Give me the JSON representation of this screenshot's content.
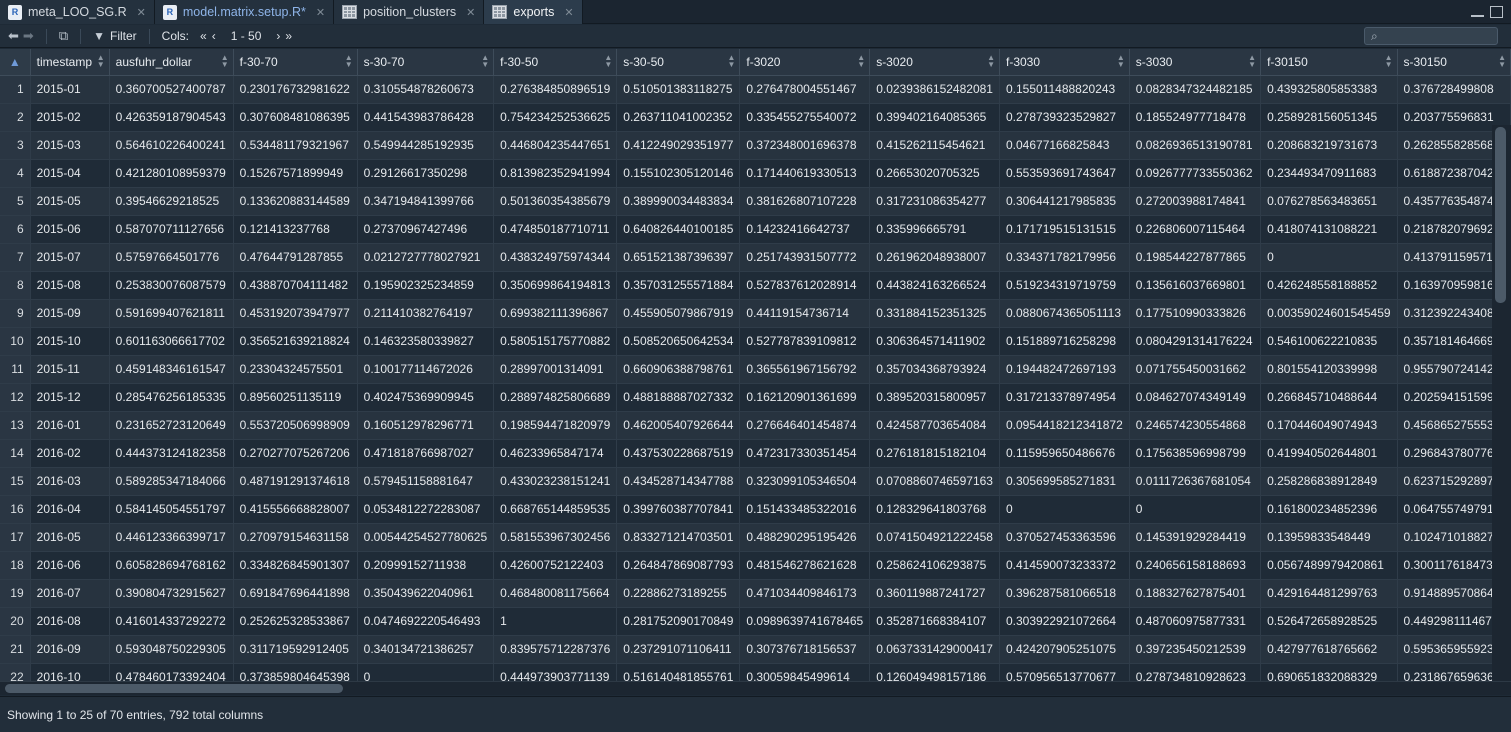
{
  "tabs": [
    {
      "label": "meta_LOO_SG.R",
      "type": "r-file",
      "modified": false,
      "active": false
    },
    {
      "label": "model.matrix.setup.R*",
      "type": "r-file",
      "modified": true,
      "active": false
    },
    {
      "label": "position_clusters",
      "type": "data",
      "modified": false,
      "active": false
    },
    {
      "label": "exports",
      "type": "data",
      "modified": false,
      "active": true
    }
  ],
  "toolbar": {
    "filter_label": "Filter",
    "cols_label": "Cols:",
    "col_range": "1 - 50"
  },
  "columns": [
    "timestamp",
    "ausfuhr_dollar",
    "f-30-70",
    "s-30-70",
    "f-30-50",
    "s-30-50",
    "f-3020",
    "s-3020",
    "f-3030",
    "s-3030",
    "f-30150",
    "s-30150"
  ],
  "rows": [
    [
      "1",
      "2015-01",
      "0.360700527400787",
      "0.230176732981622",
      "0.310554878260673",
      "0.276384850896519",
      "0.510501383118275",
      "0.276478004551467",
      "0.0239386152482081",
      "0.155011488820243",
      "0.0828347324482185",
      "0.439325805853383",
      "0.376728499808"
    ],
    [
      "2",
      "2015-02",
      "0.426359187904543",
      "0.307608481086395",
      "0.441543983786428",
      "0.754234252536625",
      "0.263711041002352",
      "0.335455275540072",
      "0.399402164085365",
      "0.278739323529827",
      "0.185524977718478",
      "0.258928156051345",
      "0.203775596831"
    ],
    [
      "3",
      "2015-03",
      "0.564610226400241",
      "0.534481179321967",
      "0.549944285192935",
      "0.446804235447651",
      "0.412249029351977",
      "0.372348001696378",
      "0.415262115454621",
      "0.04677166825843",
      "0.0826936513190781",
      "0.208683219731673",
      "0.262855828568"
    ],
    [
      "4",
      "2015-04",
      "0.421280108959379",
      "0.15267571899949",
      "0.29126617350298",
      "0.813982352941994",
      "0.155102305120146",
      "0.171440619330513",
      "0.26653020705325",
      "0.553593691743647",
      "0.0926777733550362",
      "0.234493470911683",
      "0.618872387042"
    ],
    [
      "5",
      "2015-05",
      "0.39546629218525",
      "0.133620883144589",
      "0.347194841399766",
      "0.501360354385679",
      "0.389990034483834",
      "0.381626807107228",
      "0.317231086354277",
      "0.306441217985835",
      "0.272003988174841",
      "0.076278563483651",
      "0.435776354874"
    ],
    [
      "6",
      "2015-06",
      "0.587070711127656",
      "0.121413237768",
      "0.27370967427496",
      "0.474850187710711",
      "0.640826440100185",
      "0.14232416642737",
      "0.335996665791",
      "0.171719515131515",
      "0.226806007115464",
      "0.418074131088221",
      "0.218782079692"
    ],
    [
      "7",
      "2015-07",
      "0.57597664501776",
      "0.47644791287855",
      "0.0212727778027921",
      "0.438324975974344",
      "0.651521387396397",
      "0.251743931507772",
      "0.261962048938007",
      "0.334371782179956",
      "0.198544227877865",
      "0",
      "0.413791159571"
    ],
    [
      "8",
      "2015-08",
      "0.253830076087579",
      "0.438870704111482",
      "0.195902325234859",
      "0.350699864194813",
      "0.357031255571884",
      "0.527837612028914",
      "0.443824163266524",
      "0.519234319719759",
      "0.135616037669801",
      "0.426248558188852",
      "0.163970959816"
    ],
    [
      "9",
      "2015-09",
      "0.591699407621811",
      "0.453192073947977",
      "0.211410382764197",
      "0.699382111396867",
      "0.455905079867919",
      "0.44119154736714",
      "0.331884152351325",
      "0.0880674365051113",
      "0.177510990333826",
      "0.00359024601545459",
      "0.312392243408"
    ],
    [
      "10",
      "2015-10",
      "0.601163066617702",
      "0.356521639218824",
      "0.146323580339827",
      "0.580515175770882",
      "0.508520650642534",
      "0.527787839109812",
      "0.306364571411902",
      "0.151889716258298",
      "0.0804291314176224",
      "0.546100622210835",
      "0.357181464669"
    ],
    [
      "11",
      "2015-11",
      "0.459148346161547",
      "0.23304324575501",
      "0.100177114672026",
      "0.28997001314091",
      "0.660906388798761",
      "0.365561967156792",
      "0.357034368793924",
      "0.194482472697193",
      "0.071755450031662",
      "0.801554120339998",
      "0.955790724142"
    ],
    [
      "12",
      "2015-12",
      "0.285476256185335",
      "0.89560251135119",
      "0.402475369909945",
      "0.288974825806689",
      "0.488188887027332",
      "0.162120901361699",
      "0.389520315800957",
      "0.317213378974954",
      "0.084627074349149",
      "0.266845710488644",
      "0.202594151599"
    ],
    [
      "13",
      "2016-01",
      "0.231652723120649",
      "0.553720506998909",
      "0.160512978296771",
      "0.198594471820979",
      "0.462005407926644",
      "0.276646401454874",
      "0.424587703654084",
      "0.0954418212341872",
      "0.246574230554868",
      "0.170446049074943",
      "0.456865275553"
    ],
    [
      "14",
      "2016-02",
      "0.444373124182358",
      "0.270277075267206",
      "0.471818766987027",
      "0.46233965847174",
      "0.437530228687519",
      "0.472317330351454",
      "0.276181815182104",
      "0.115959650486676",
      "0.175638596998799",
      "0.419940502644801",
      "0.296843780776"
    ],
    [
      "15",
      "2016-03",
      "0.589285347184066",
      "0.487191291374618",
      "0.579451158881647",
      "0.433023238151241",
      "0.434528714347788",
      "0.323099105346504",
      "0.0708860746597163",
      "0.305699585271831",
      "0.0111726367681054",
      "0.258286838912849",
      "0.623715292897"
    ],
    [
      "16",
      "2016-04",
      "0.584145054551797",
      "0.415556668828007",
      "0.0534812272283087",
      "0.668765144859535",
      "0.399760387707841",
      "0.151433485322016",
      "0.128329641803768",
      "0",
      "0",
      "0.161800234852396",
      "0.064755749791"
    ],
    [
      "17",
      "2016-05",
      "0.446123366399717",
      "0.270979154631158",
      "0.00544254527780625",
      "0.581553967302456",
      "0.833271214703501",
      "0.488290295195426",
      "0.0741504921222458",
      "0.370527453363596",
      "0.145391929284419",
      "0.13959833548449",
      "0.102471018827"
    ],
    [
      "18",
      "2016-06",
      "0.605828694768162",
      "0.334826845901307",
      "0.20999152711938",
      "0.42600752122403",
      "0.264847869087793",
      "0.481546278621628",
      "0.258624106293875",
      "0.414590073233372",
      "0.240656158188693",
      "0.0567489979420861",
      "0.300117618473"
    ],
    [
      "19",
      "2016-07",
      "0.390804732915627",
      "0.691847696441898",
      "0.350439622040961",
      "0.468480081175664",
      "0.22886273189255",
      "0.471034409846173",
      "0.360119887241727",
      "0.396287581066518",
      "0.188327627875401",
      "0.429164481299763",
      "0.914889570864"
    ],
    [
      "20",
      "2016-08",
      "0.416014337292272",
      "0.252625328533867",
      "0.0474692220546493",
      "1",
      "0.281752090170849",
      "0.0989639741678465",
      "0.352871668384107",
      "0.303922921072664",
      "0.487060975877331",
      "0.526472658928525",
      "0.449298111467"
    ],
    [
      "21",
      "2016-09",
      "0.593048750229305",
      "0.311719592912405",
      "0.340134721386257",
      "0.839575712287376",
      "0.237291071106411",
      "0.307376718156537",
      "0.0637331429000417",
      "0.424207905251075",
      "0.397235450212539",
      "0.427977618765662",
      "0.595365955923"
    ],
    [
      "22",
      "2016-10",
      "0.478460173392404",
      "0.373859804645398",
      "0",
      "0.444973903771139",
      "0.516140481855761",
      "0.30059845499614",
      "0.126049498157186",
      "0.570956513770677",
      "0.278734810928623",
      "0.690651832088329",
      "0.231867659636"
    ]
  ],
  "status": {
    "text": "Showing 1 to 25 of 70 entries, 792 total columns"
  }
}
